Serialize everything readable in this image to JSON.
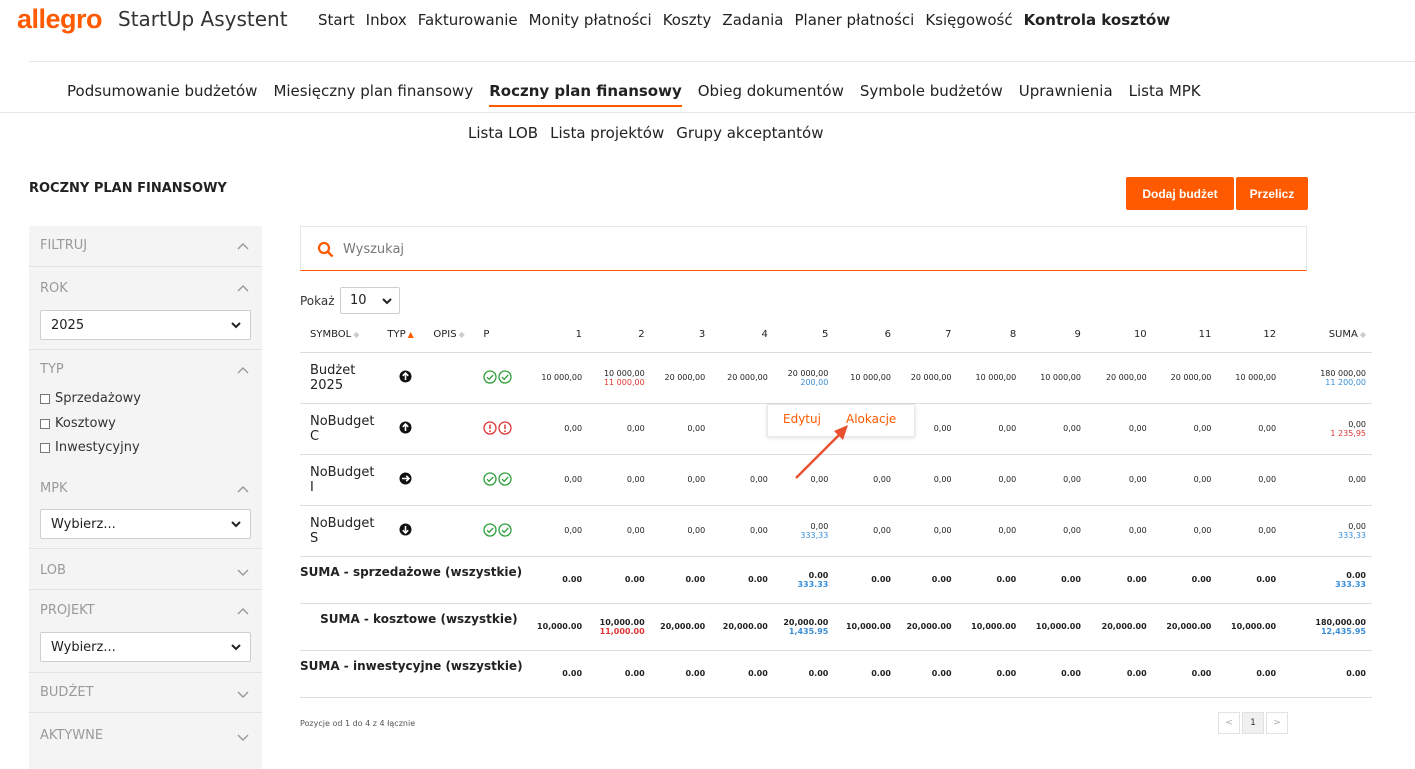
{
  "header": {
    "logo": "allegro",
    "app_name": "StartUp Asystent",
    "nav": [
      "Start",
      "Inbox",
      "Fakturowanie",
      "Monity płatności",
      "Koszty",
      "Zadania",
      "Planer płatności",
      "Księgowość",
      "Kontrola kosztów"
    ],
    "active_nav": "Kontrola kosztów"
  },
  "subnav": {
    "row1": [
      "Podsumowanie budżetów",
      "Miesięczny plan finansowy",
      "Roczny plan finansowy",
      "Obieg dokumentów",
      "Symbole budżetów",
      "Uprawnienia",
      "Lista MPK"
    ],
    "row2": [
      "Lista LOB",
      "Lista projektów",
      "Grupy akceptantów"
    ],
    "active": "Roczny plan finansowy"
  },
  "page": {
    "title": "ROCZNY PLAN FINANSOWY",
    "add_budget": "Dodaj budżet",
    "recalc": "Przelicz"
  },
  "sidebar": {
    "filter": "FILTRUJ",
    "year_label": "ROK",
    "year_value": "2025",
    "type_label": "TYP",
    "types": [
      "Sprzedażowy",
      "Kosztowy",
      "Inwestycyjny"
    ],
    "mpk_label": "MPK",
    "mpk_value": "Wybierz...",
    "lob_label": "LOB",
    "project_label": "PROJEKT",
    "project_value": "Wybierz...",
    "budget_label": "BUDŻET",
    "active_label": "AKTYWNE"
  },
  "search": {
    "placeholder": "Wyszukaj"
  },
  "show": {
    "label": "Pokaż",
    "value": "10"
  },
  "table": {
    "headers": {
      "symbol": "SYMBOL",
      "typ": "TYP",
      "opis": "OPIS",
      "p": "P",
      "months": [
        "1",
        "2",
        "3",
        "4",
        "5",
        "6",
        "7",
        "8",
        "9",
        "10",
        "11",
        "12"
      ],
      "suma": "SUMA"
    },
    "rows": [
      {
        "symbol": "Budżet 2025",
        "status": "ok",
        "months": [
          {
            "v": "10 000,00"
          },
          {
            "v": "10 000,00",
            "red": "11 000,00"
          },
          {
            "v": "20 000,00"
          },
          {
            "v": "20 000,00"
          },
          {
            "v": "20 000,00",
            "blue": "200,00"
          },
          {
            "v": "10 000,00"
          },
          {
            "v": "20 000,00"
          },
          {
            "v": "10 000,00"
          },
          {
            "v": "10 000,00"
          },
          {
            "v": "20 000,00"
          },
          {
            "v": "20 000,00"
          },
          {
            "v": "10 000,00"
          }
        ],
        "suma": {
          "v": "180 000,00",
          "blue": "11 200,00"
        }
      },
      {
        "symbol": "NoBudget C",
        "status": "error",
        "months": [
          {
            "v": "0,00"
          },
          {
            "v": "0,00"
          },
          {
            "v": "0,00"
          },
          {
            "v": ""
          },
          {
            "v": ""
          },
          {
            "v": ""
          },
          {
            "v": "0,00"
          },
          {
            "v": "0,00"
          },
          {
            "v": "0,00"
          },
          {
            "v": "0,00"
          },
          {
            "v": "0,00"
          },
          {
            "v": "0,00"
          }
        ],
        "suma": {
          "v": "0,00",
          "red": "1 235,95"
        }
      },
      {
        "symbol": "NoBudget I",
        "status": "ok",
        "months": [
          {
            "v": "0,00"
          },
          {
            "v": "0,00"
          },
          {
            "v": "0,00"
          },
          {
            "v": "0,00"
          },
          {
            "v": "0,00"
          },
          {
            "v": "0,00"
          },
          {
            "v": "0,00"
          },
          {
            "v": "0,00"
          },
          {
            "v": "0,00"
          },
          {
            "v": "0,00"
          },
          {
            "v": "0,00"
          },
          {
            "v": "0,00"
          }
        ],
        "suma": {
          "v": "0,00"
        }
      },
      {
        "symbol": "NoBudget S",
        "status": "ok",
        "months": [
          {
            "v": "0,00"
          },
          {
            "v": "0,00"
          },
          {
            "v": "0,00"
          },
          {
            "v": "0,00"
          },
          {
            "v": "0,00",
            "blue": "333,33"
          },
          {
            "v": "0,00"
          },
          {
            "v": "0,00"
          },
          {
            "v": "0,00"
          },
          {
            "v": "0,00"
          },
          {
            "v": "0,00"
          },
          {
            "v": "0,00"
          },
          {
            "v": "0,00"
          }
        ],
        "suma": {
          "v": "0,00",
          "blue": "333,33"
        }
      }
    ],
    "sums": [
      {
        "label": "SUMA - sprzedażowe (wszystkie)",
        "months": [
          {
            "v": "0.00"
          },
          {
            "v": "0.00"
          },
          {
            "v": "0.00"
          },
          {
            "v": "0.00"
          },
          {
            "v": "0.00",
            "blue": "333.33"
          },
          {
            "v": "0.00"
          },
          {
            "v": "0.00"
          },
          {
            "v": "0.00"
          },
          {
            "v": "0.00"
          },
          {
            "v": "0.00"
          },
          {
            "v": "0.00"
          },
          {
            "v": "0.00"
          }
        ],
        "suma": {
          "v": "0.00",
          "blue": "333.33"
        }
      },
      {
        "label": "SUMA - kosztowe (wszystkie)",
        "months": [
          {
            "v": "10,000.00"
          },
          {
            "v": "10,000.00",
            "red": "11,000.00"
          },
          {
            "v": "20,000.00"
          },
          {
            "v": "20,000.00"
          },
          {
            "v": "20,000.00",
            "blue": "1,435.95"
          },
          {
            "v": "10,000.00"
          },
          {
            "v": "20,000.00"
          },
          {
            "v": "10,000.00"
          },
          {
            "v": "10,000.00"
          },
          {
            "v": "20,000.00"
          },
          {
            "v": "20,000.00"
          },
          {
            "v": "10,000.00"
          }
        ],
        "suma": {
          "v": "180,000.00",
          "blue": "12,435.95"
        }
      },
      {
        "label": "SUMA - inwestycyjne (wszystkie)",
        "months": [
          {
            "v": "0.00"
          },
          {
            "v": "0.00"
          },
          {
            "v": "0.00"
          },
          {
            "v": "0.00"
          },
          {
            "v": "0.00"
          },
          {
            "v": "0.00"
          },
          {
            "v": "0.00"
          },
          {
            "v": "0.00"
          },
          {
            "v": "0.00"
          },
          {
            "v": "0.00"
          },
          {
            "v": "0.00"
          },
          {
            "v": "0.00"
          }
        ],
        "suma": {
          "v": "0.00"
        }
      }
    ]
  },
  "popup": {
    "edit": "Edytuj",
    "alloc": "Alokacje"
  },
  "footer": {
    "info": "Pozycje od 1 do 4 z 4 łącznie",
    "page": "1",
    "prev": "<",
    "next": ">"
  },
  "colors": {
    "accent": "#ff5a00",
    "red": "#e03535",
    "blue": "#3a8ed8",
    "ok": "#2e9e3a"
  }
}
